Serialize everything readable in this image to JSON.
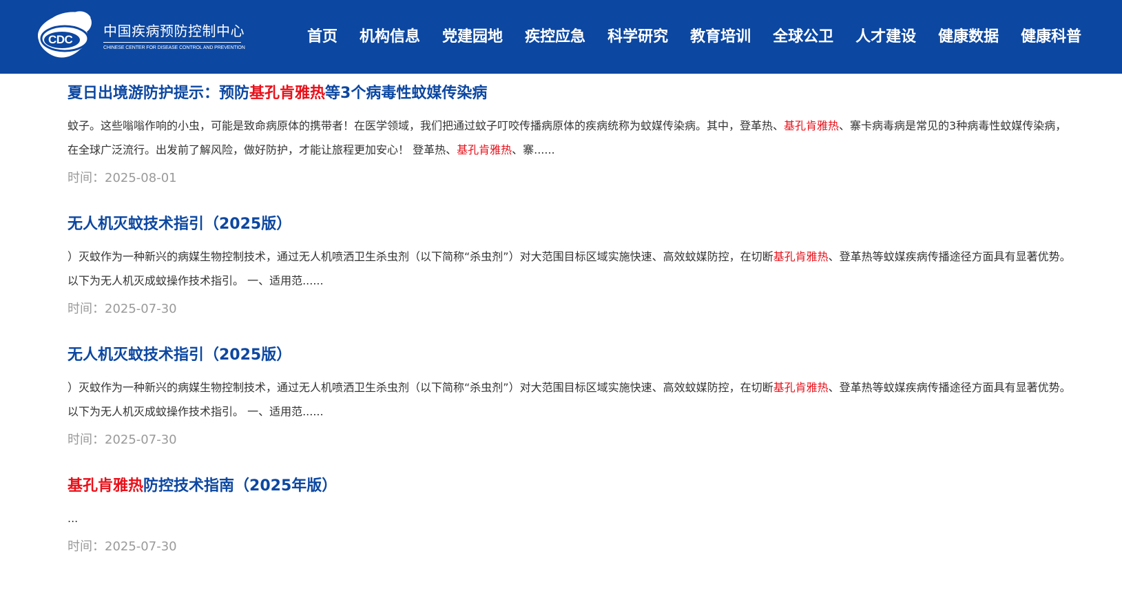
{
  "header": {
    "logo_abbr": "CDC",
    "logo_cn": "中国疾病预防控制中心",
    "logo_en": "CHINESE CENTER FOR DISEASE CONTROL AND PREVENTION",
    "bg_color": "#0c47a1",
    "nav": [
      "首页",
      "机构信息",
      "党建园地",
      "疾控应急",
      "科学研究",
      "教育培训",
      "全球公卫",
      "人才建设",
      "健康数据",
      "健康科普"
    ]
  },
  "colors": {
    "title": "#0c47a1",
    "highlight": "#e8101a",
    "time": "#9a9a9a",
    "text": "#333333"
  },
  "results": [
    {
      "title_pre": "夏日出境游防护提示：预防",
      "title_hl": "基孔肯雅热",
      "title_post": "等3个病毒性蚊媒传染病",
      "snippet_a": "蚊子。这些嗡嗡作响的小虫，可能是致命病原体的携带者！在医学领域，我们把通过蚊子叮咬传播病原体的疾病统称为蚊媒传染病。其中，登革热、",
      "snippet_hl1": "基孔肯雅热",
      "snippet_b": "、寨卡病毒病是常见的3种病毒性蚊媒传染病，在全球广泛流行。出发前了解风险，做好防护，才能让旅程更加安心！ 登革热、",
      "snippet_hl2": "基孔肯雅热",
      "snippet_c": "、寨......",
      "time": "时间：2025-08-01"
    },
    {
      "title_pre": "无人机灭蚊技术指引（2025版）",
      "title_hl": "",
      "title_post": "",
      "snippet_a": "）灭蚊作为一种新兴的病媒生物控制技术，通过无人机喷洒卫生杀虫剂（以下简称“杀虫剂”）对大范围目标区域实施快速、高效蚊媒防控，在切断",
      "snippet_hl1": "基孔肯雅热",
      "snippet_b": "、登革热等蚊媒疾病传播途径方面具有显著优势。以下为无人机灭成蚊操作技术指引。 一、适用范......",
      "snippet_hl2": "",
      "snippet_c": "",
      "time": "时间：2025-07-30"
    },
    {
      "title_pre": "无人机灭蚊技术指引（2025版）",
      "title_hl": "",
      "title_post": "",
      "snippet_a": "）灭蚊作为一种新兴的病媒生物控制技术，通过无人机喷洒卫生杀虫剂（以下简称“杀虫剂”）对大范围目标区域实施快速、高效蚊媒防控，在切断",
      "snippet_hl1": "基孔肯雅热",
      "snippet_b": "、登革热等蚊媒疾病传播途径方面具有显著优势。以下为无人机灭成蚊操作技术指引。 一、适用范......",
      "snippet_hl2": "",
      "snippet_c": "",
      "time": "时间：2025-07-30"
    },
    {
      "title_pre": "",
      "title_hl": "基孔肯雅热",
      "title_post": "防控技术指南（2025年版）",
      "snippet_a": "...",
      "snippet_hl1": "",
      "snippet_b": "",
      "snippet_hl2": "",
      "snippet_c": "",
      "time": "时间：2025-07-30"
    }
  ]
}
